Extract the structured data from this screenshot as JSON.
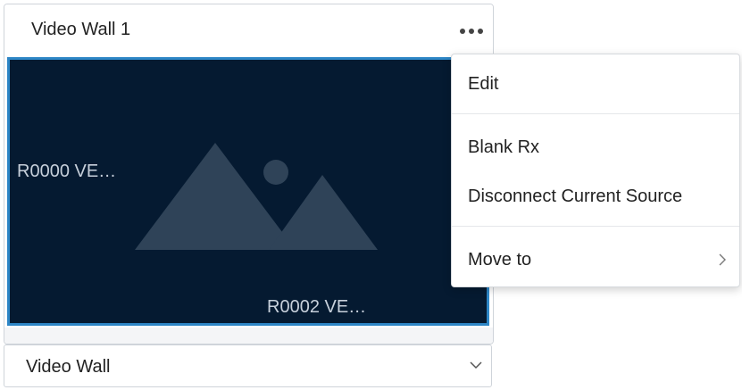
{
  "panel": {
    "title": "Video Wall 1",
    "more_icon": "more-horizontal-icon"
  },
  "preview": {
    "placeholder_icon": "image-placeholder-icon",
    "labels": [
      "R0000 VE…",
      "R0002 VE…"
    ]
  },
  "wall_select": {
    "value": "Video Wall",
    "icon": "chevron-down-icon"
  },
  "context_menu": {
    "items": [
      {
        "label": "Edit"
      },
      {
        "label": "Blank Rx"
      },
      {
        "label": "Disconnect Current Source"
      },
      {
        "label": "Move to",
        "icon": "chevron-right-icon"
      }
    ]
  },
  "colors": {
    "preview_background": "#051a31",
    "selection_border": "#2d86c6",
    "placeholder_art": "#2f4358"
  }
}
